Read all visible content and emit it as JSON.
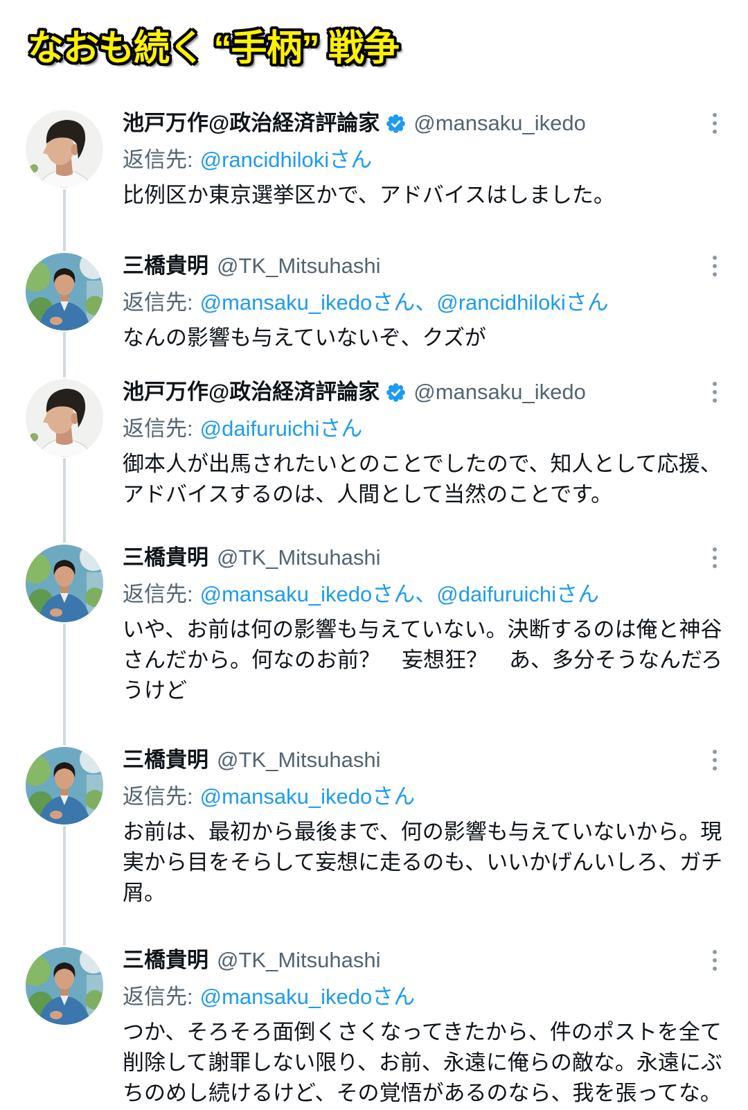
{
  "title": "なおも続く “手柄” 戦争",
  "labels": {
    "reply_to": "返信先:"
  },
  "reply_separator": "、",
  "colors": {
    "text": "#0f1419",
    "secondary_text": "#536471",
    "link": "#1d9bf0",
    "verified_badge": "#1d9bf0",
    "thread_line": "#cfd9de",
    "more_icon": "#8b98a5",
    "title_fill": "#fff200",
    "title_outline": "#000000",
    "background": "#ffffff"
  },
  "icons": {
    "verified": "verified-badge-icon",
    "more": "more-options-icon"
  },
  "tweets": [
    {
      "display_name": "池戸万作@政治経済評論家",
      "verified": true,
      "handle": "@mansaku_ikedo",
      "reply_to": [
        "@rancidhilokiさん"
      ],
      "body_lines": [
        "比例区か東京選挙区かで、アドバイスはしました。"
      ]
    },
    {
      "display_name": "三橋貴明",
      "verified": false,
      "handle": "@TK_Mitsuhashi",
      "reply_to": [
        "@mansaku_ikedoさん",
        "@rancidhilokiさん"
      ],
      "body_lines": [
        "なんの影響も与えていないぞ、クズが"
      ]
    },
    {
      "display_name": "池戸万作@政治経済評論家",
      "verified": true,
      "handle": "@mansaku_ikedo",
      "reply_to": [
        "@daifuruichiさん"
      ],
      "body_lines": [
        "御本人が出馬されたいとのことでしたので、知人として応援、",
        "アドバイスするのは、人間として当然のことです。"
      ]
    },
    {
      "display_name": "三橋貴明",
      "verified": false,
      "handle": "@TK_Mitsuhashi",
      "reply_to": [
        "@mansaku_ikedoさん",
        "@daifuruichiさん"
      ],
      "body_lines": [
        "いや、お前は何の影響も与えていない。決断するのは俺と神谷",
        "さんだから。何なのお前？　妄想狂？　あ、多分そうなんだろ",
        "うけど"
      ]
    },
    {
      "display_name": "三橋貴明",
      "verified": false,
      "handle": "@TK_Mitsuhashi",
      "reply_to": [
        "@mansaku_ikedoさん"
      ],
      "body_lines": [
        "お前は、最初から最後まで、何の影響も与えていないから。現",
        "実から目をそらして妄想に走るのも、いいかげんいしろ、ガチ",
        "屑。"
      ]
    },
    {
      "display_name": "三橋貴明",
      "verified": false,
      "handle": "@TK_Mitsuhashi",
      "reply_to": [
        "@mansaku_ikedoさん"
      ],
      "body_lines": [
        "つか、そろそろ面倒くさくなってきたから、件のポストを全て",
        "削除して謝罪しない限り、お前、永遠に俺らの敵な。永遠にぶ",
        "ちのめし続けるけど、その覚悟があるのなら、我を張ってな。"
      ]
    }
  ]
}
